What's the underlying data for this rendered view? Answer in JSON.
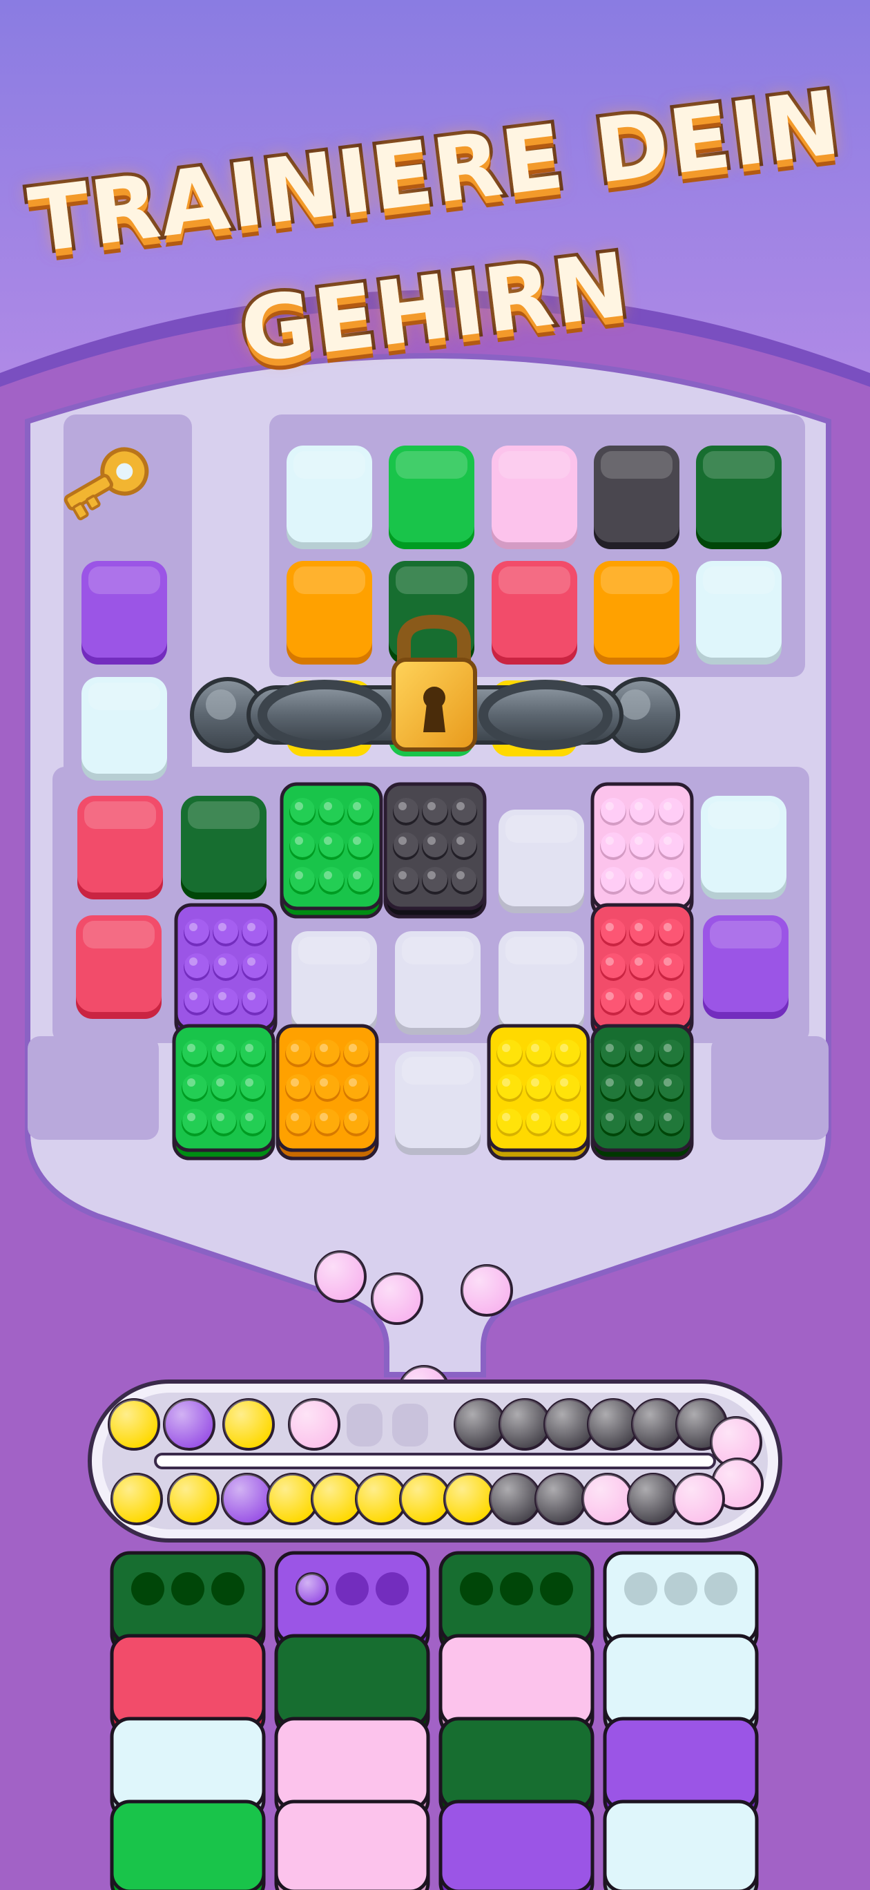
{
  "banner": {
    "line1": "TRAINIERE DEIN",
    "line2": "GEHIRN"
  },
  "colors": {
    "background": "#a262c6",
    "banner_top": "#9a86e6",
    "board": "#cfc8ea",
    "accent": "#f39a2a"
  },
  "board": {
    "key_icon": "key-icon",
    "lock_icon": "padlock-icon",
    "chain_icon": "chain-icon"
  },
  "conveyor": {
    "icon": "conveyor-belt"
  },
  "containers": {
    "icon": "ball-container"
  }
}
